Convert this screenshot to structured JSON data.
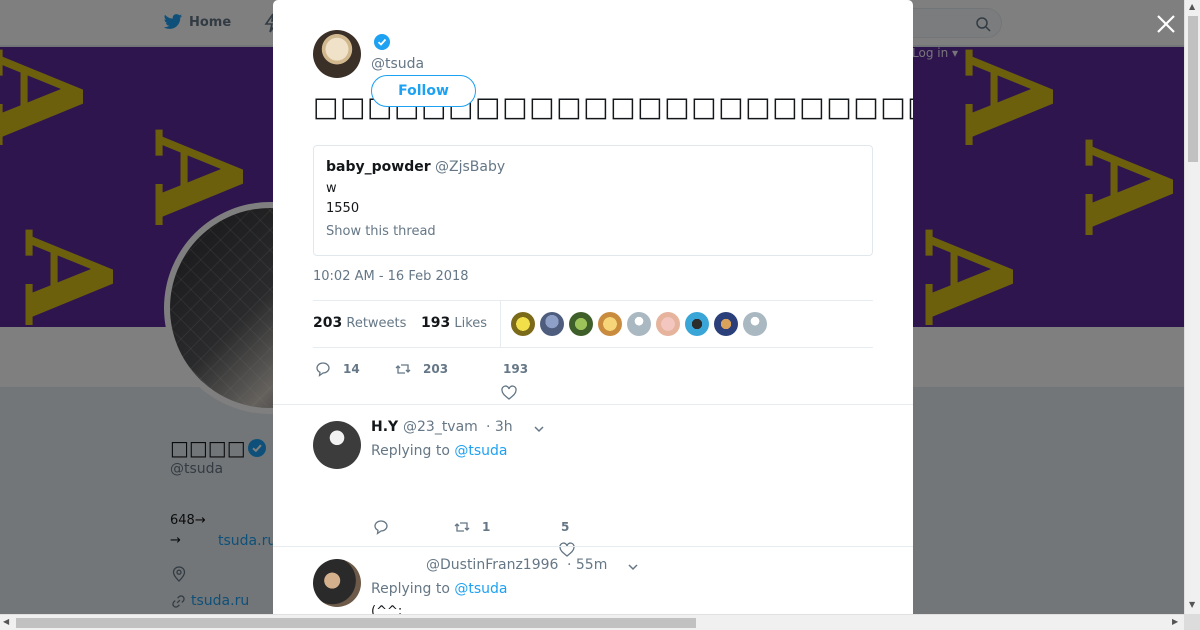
{
  "nav": {
    "home_label": "Home",
    "login_label": "Log in ▾"
  },
  "profile": {
    "name": "□□□□",
    "handle": "@tsuda",
    "count_line": "648→",
    "arrow_line": "→",
    "url_short": "tsuda.ru",
    "link": "tsuda.ru"
  },
  "tweet": {
    "handle": "@tsuda",
    "follow_label": "Follow",
    "text": "□□□□□□□□□□□□□□□□□□□□□□□□□□□□□□□□",
    "quote": {
      "name": "baby_powder",
      "handle": "@ZjsBaby",
      "line1": "w",
      "line2": "1550",
      "thread_link": "Show this thread"
    },
    "timestamp": "10:02 AM - 16 Feb 2018",
    "retweets_count": "203",
    "retweets_label": "Retweets",
    "likes_count": "193",
    "likes_label": "Likes",
    "actions": {
      "replies": "14",
      "retweets": "203",
      "likes": "193"
    }
  },
  "replies": [
    {
      "name": "H.Y",
      "handle": "@23_tvam",
      "time": "· 3h",
      "replying_prefix": "Replying to",
      "replying_to": "@tsuda",
      "body": "",
      "retweets": "1",
      "likes": "5"
    },
    {
      "name": "",
      "handle": "@DustinFranz1996",
      "time": "· 55m",
      "replying_prefix": "Replying to",
      "replying_to": "@tsuda",
      "body": "(^^;"
    }
  ],
  "colors": {
    "accent": "#1da1f2",
    "banner_purple": "#5d2a9b",
    "banner_yellow": "#d8c11a",
    "muted": "#657786"
  }
}
